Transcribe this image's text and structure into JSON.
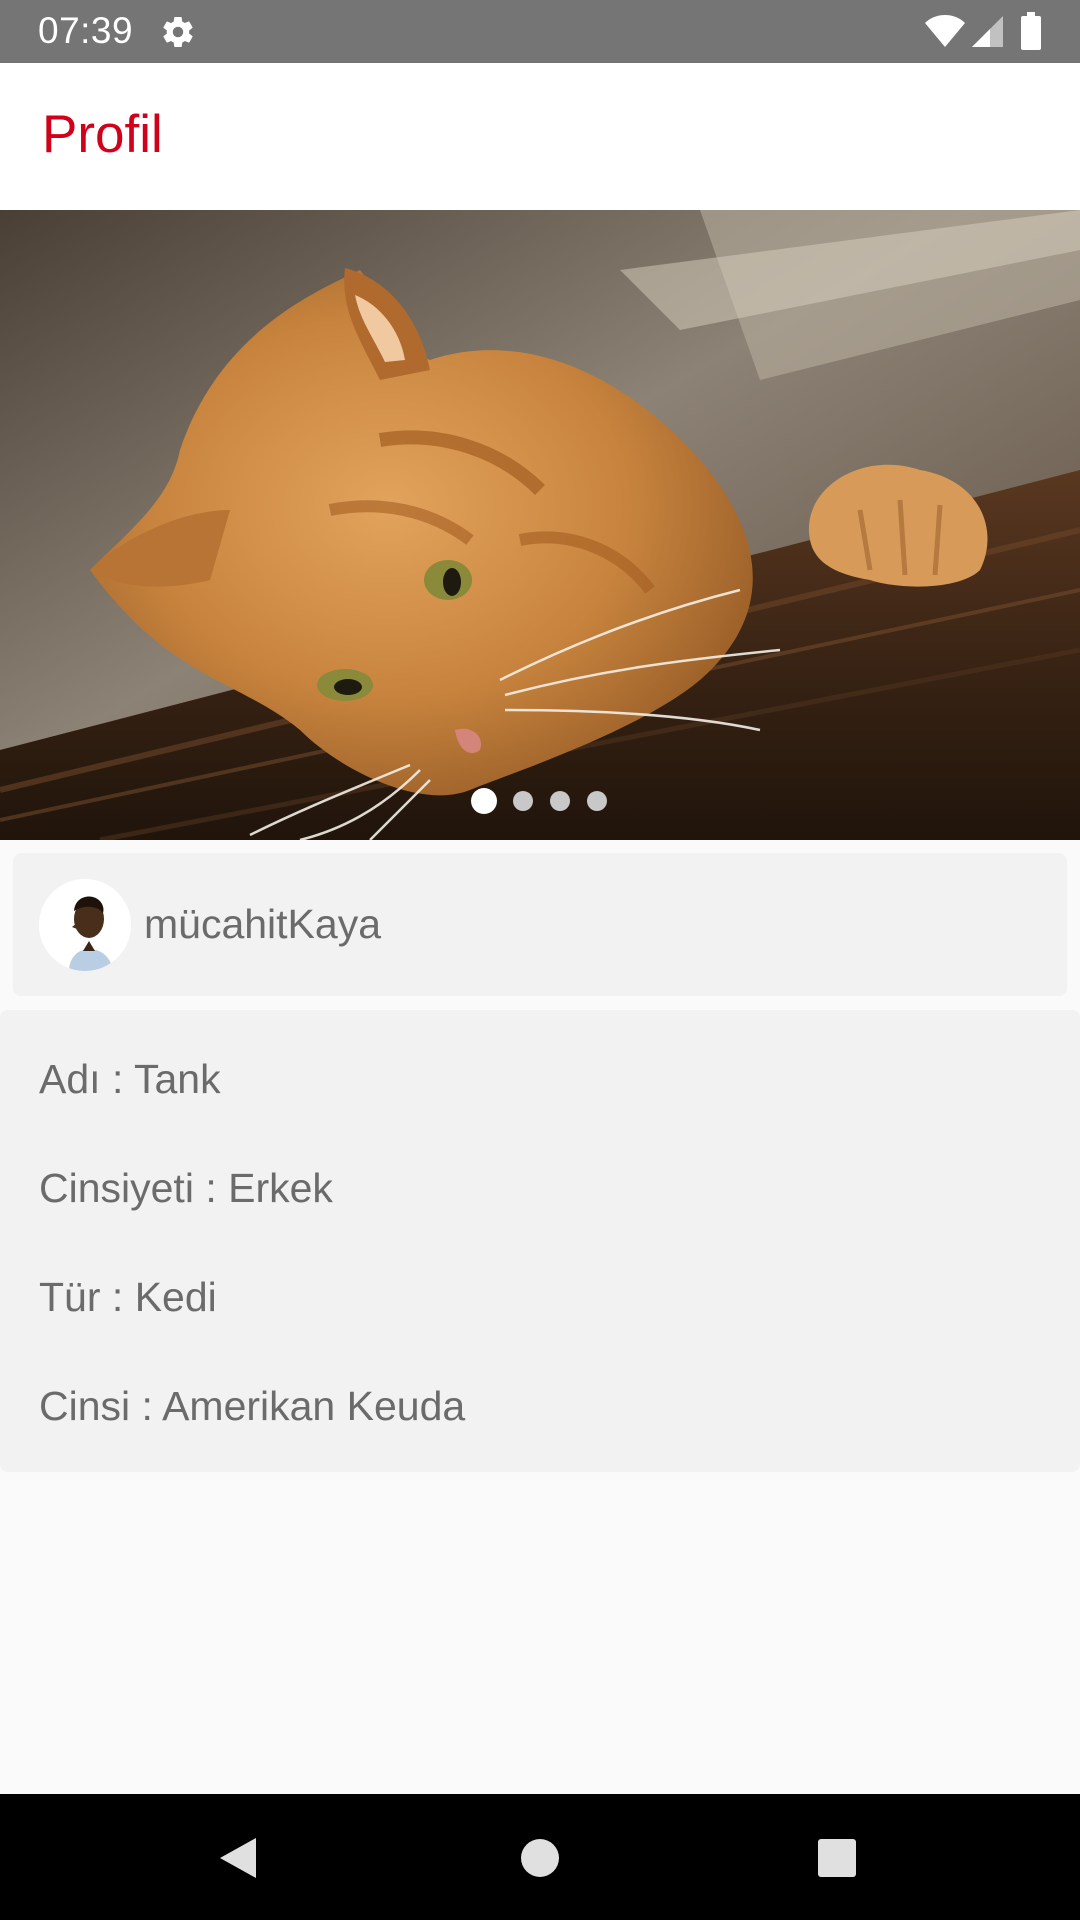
{
  "status_bar": {
    "time": "07:39",
    "icons": [
      "gear-icon",
      "wifi-icon",
      "signal-icon",
      "battery-icon"
    ],
    "color": "#757575"
  },
  "app_bar": {
    "title": "Profil",
    "title_color": "#d0021b"
  },
  "slider": {
    "image": "orange-cat-photo",
    "page_count": 4,
    "active_index": 0
  },
  "owner": {
    "avatar": "user-avatar",
    "username": "mücahitKaya"
  },
  "pet_info": [
    {
      "label": "Adı",
      "value": "Tank"
    },
    {
      "label": "Cinsiyeti",
      "value": "Erkek"
    },
    {
      "label": "Tür",
      "value": "Kedi"
    },
    {
      "label": "Cinsi",
      "value": "Amerikan Keuda"
    }
  ],
  "nav_bar": {
    "icons": [
      "back-icon",
      "home-icon",
      "recents-icon"
    ]
  }
}
